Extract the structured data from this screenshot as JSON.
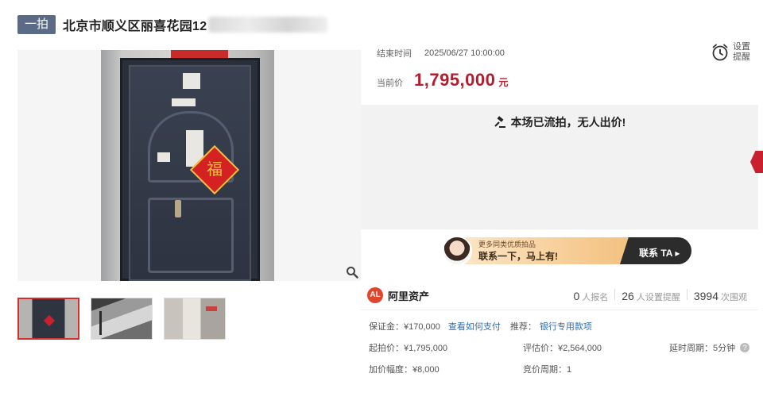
{
  "header": {
    "tag": "一拍",
    "title": "北京市顺义区丽喜花园12"
  },
  "gallery": {
    "main_icon": "door-photo",
    "thumbnails": [
      "door-photo-thumb",
      "stair-photo-thumb",
      "hallway-photo-thumb"
    ]
  },
  "auction": {
    "end_label": "结束时间",
    "end_value": "2025/06/27 10:00:00",
    "price_label": "当前价",
    "price_value": "1,795,000",
    "price_unit": "元",
    "reminder_label_1": "设置",
    "reminder_label_2": "提醒",
    "status": "本场已流拍，无人出价!",
    "accent_color": "#b51c2e"
  },
  "promo": {
    "line1": "更多同类优质拍品",
    "line2": "联系一下，马上有!",
    "cta": "联系 TA ▸"
  },
  "platform": {
    "name": "阿里资产",
    "signups_num": "0",
    "signups_label": "人报名",
    "reminders_num": "26",
    "reminders_label": "人设置提醒",
    "views_num": "3994",
    "views_label": "次围观"
  },
  "details": {
    "deposit": "保证金：¥170,000",
    "deposit_link": "查看如何支付",
    "recommend_label": "推荐：",
    "recommend_link": "银行专用款项",
    "start_price": "起拍价：¥1,795,000",
    "appraisal": "评估价：¥2,564,000",
    "delay": "延时周期：5分钟",
    "increment": "加价幅度：¥8,000",
    "bid_cycle": "竞价周期：1"
  }
}
